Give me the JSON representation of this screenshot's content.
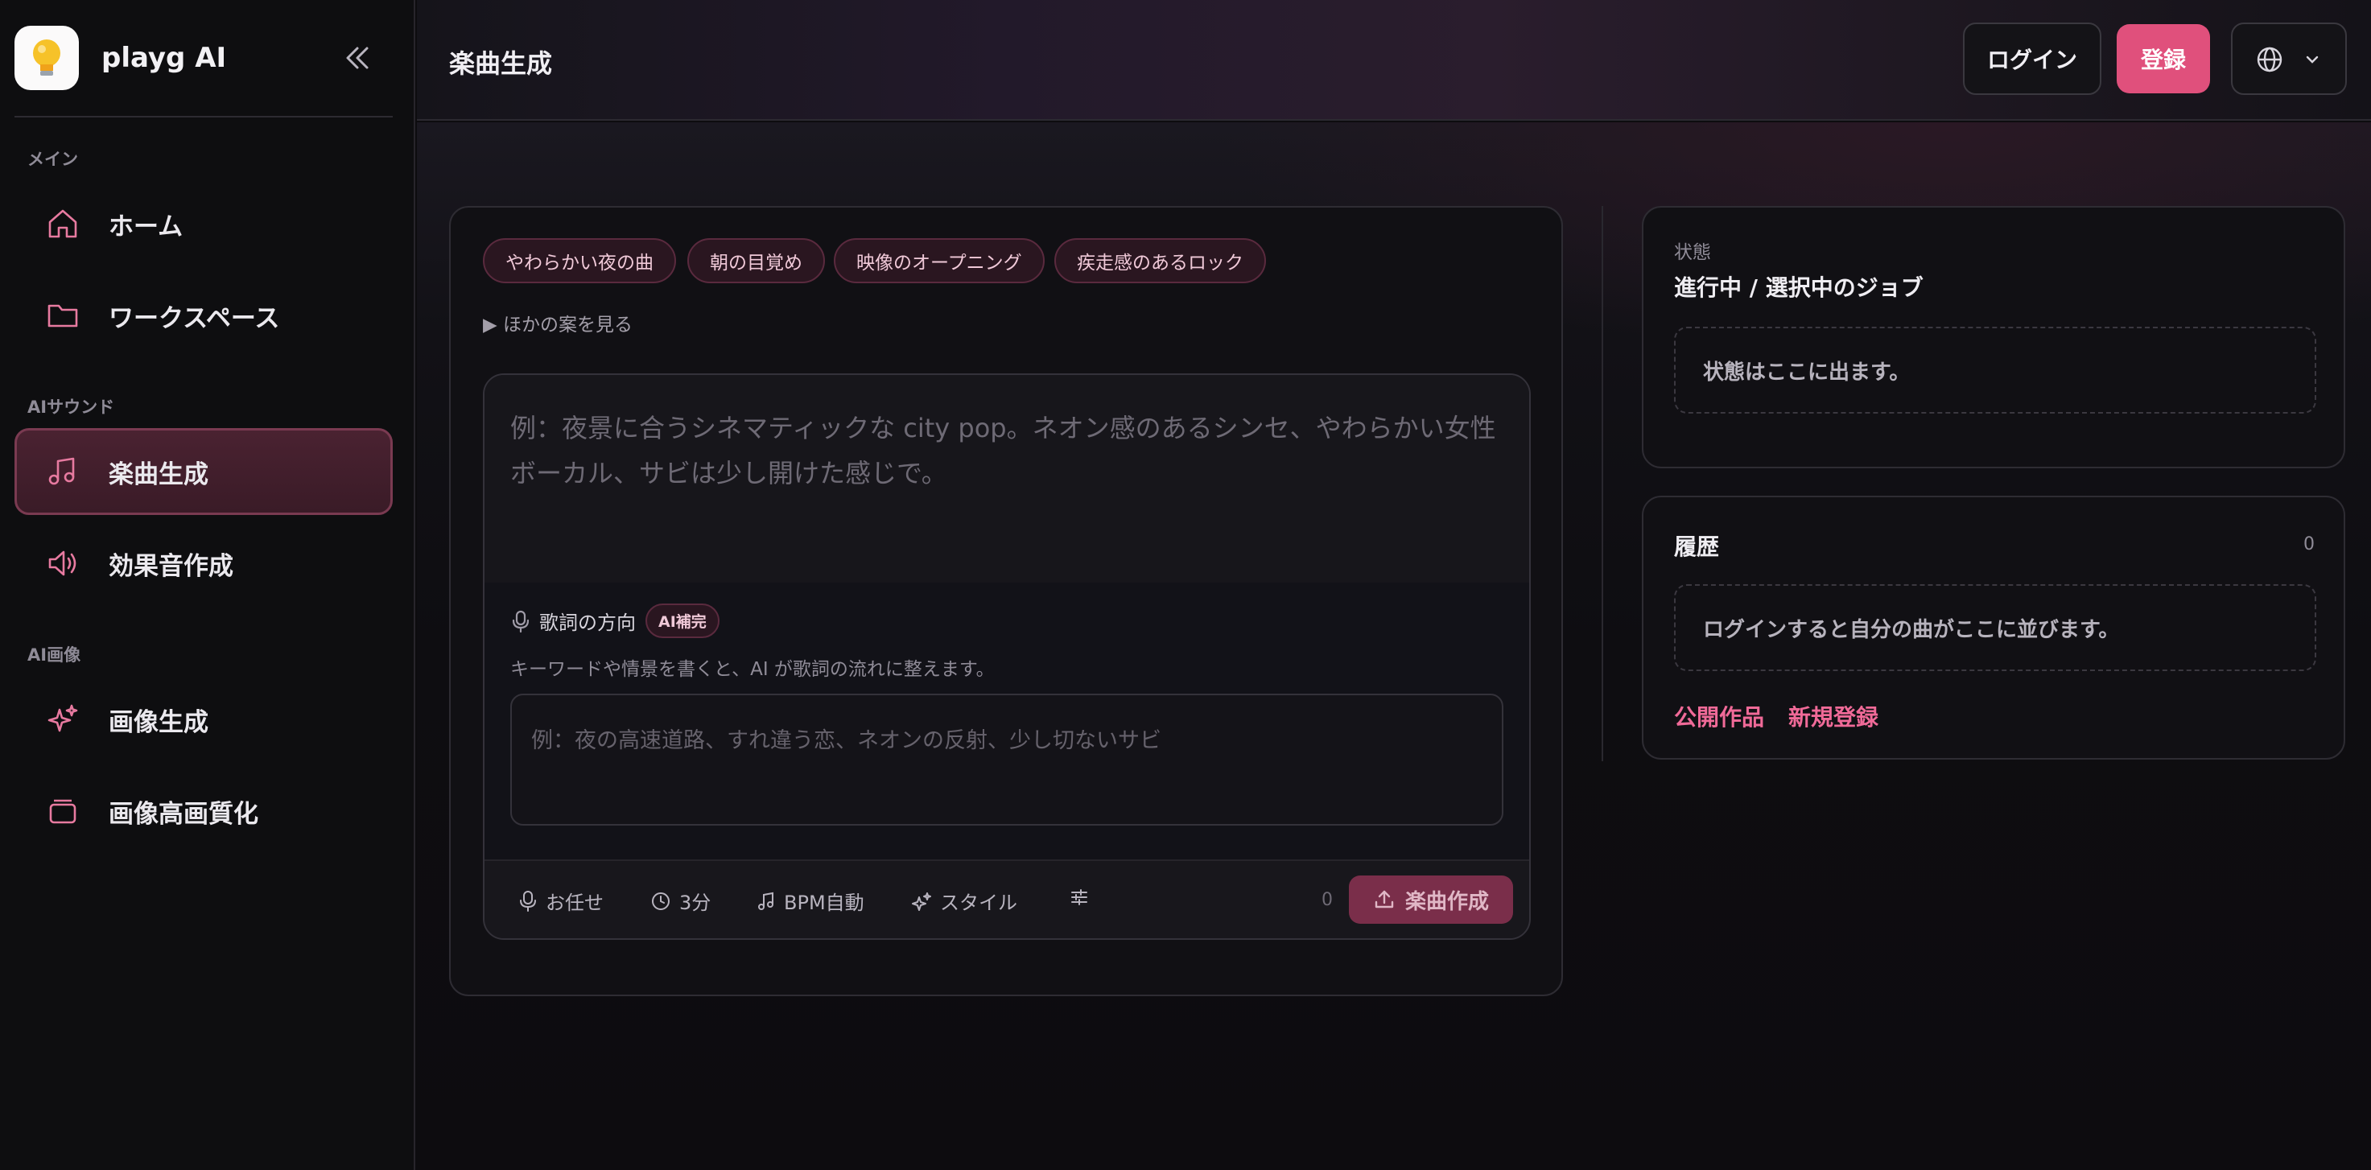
{
  "brand": {
    "name": "playg AI",
    "logo_icon": "lightbulb-icon"
  },
  "sidebar": {
    "sections": [
      {
        "label": "メイン"
      },
      {
        "label": "AIサウンド"
      },
      {
        "label": "AI画像"
      }
    ],
    "items": [
      {
        "label": "ホーム",
        "icon": "home-icon"
      },
      {
        "label": "ワークスペース",
        "icon": "folder-icon"
      },
      {
        "label": "楽曲生成",
        "icon": "music-note-icon",
        "active": true
      },
      {
        "label": "効果音作成",
        "icon": "speaker-icon"
      },
      {
        "label": "画像生成",
        "icon": "sparkles-icon"
      },
      {
        "label": "画像高画質化",
        "icon": "layers-icon"
      }
    ]
  },
  "header": {
    "title": "楽曲生成",
    "login": "ログイン",
    "register": "登録",
    "language_icon": "globe-icon"
  },
  "composer": {
    "chips": [
      "やわらかい夜の曲",
      "朝の目覚め",
      "映像のオープニング",
      "疾走感のあるロック"
    ],
    "more_ideas": "▶ ほかの案を見る",
    "prompt_placeholder": "例：夜景に合うシネマティックな city pop。ネオン感のあるシンセ、やわらかい女性ボーカル、サビは少し開けた感じで。",
    "lyrics": {
      "title": "歌詞の方向",
      "badge": "AI補完",
      "description": "キーワードや情景を書くと、AI が歌詞の流れに整えます。",
      "placeholder": "例：夜の高速道路、すれ違う恋、ネオンの反射、少し切ないサビ"
    },
    "toolbar": {
      "vocal": "お任せ",
      "duration": "3分",
      "bpm": "BPM自動",
      "style": "スタイル",
      "count": "0",
      "create": "楽曲作成"
    }
  },
  "status": {
    "label": "状態",
    "title": "進行中 / 選択中のジョブ",
    "empty": "状態はここに出ます。"
  },
  "history": {
    "title": "履歴",
    "count": "0",
    "empty": "ログインすると自分の曲がここに並びます。",
    "link_public": "公開作品",
    "link_signup": "新規登録"
  },
  "colors": {
    "accent": "#e0507c",
    "link": "#f06a98",
    "active_bg": "#4a2231"
  }
}
